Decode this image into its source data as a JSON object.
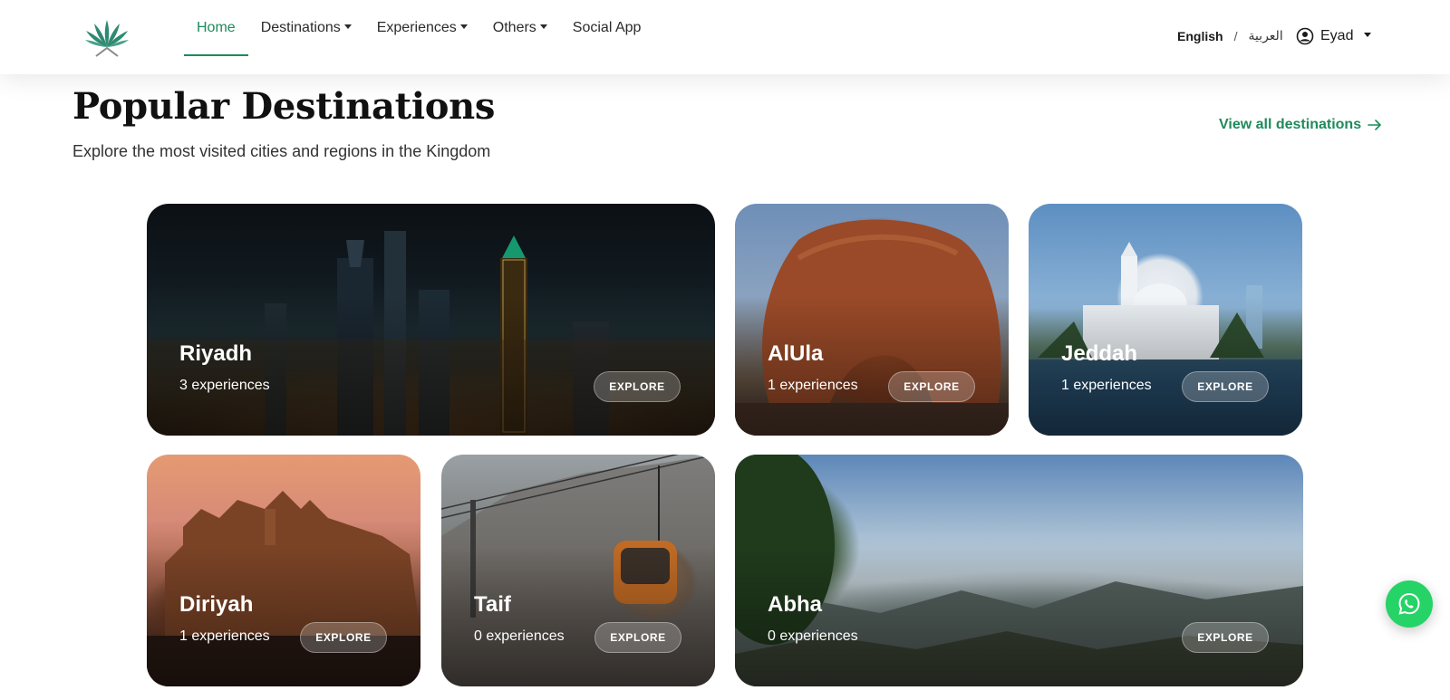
{
  "colors": {
    "accent": "#1f8a5b",
    "whatsapp": "#25d366"
  },
  "nav": {
    "items": [
      {
        "label": "Home",
        "icon": "",
        "active": true,
        "dropdown": false
      },
      {
        "label": "Destinations",
        "dropdown": true
      },
      {
        "label": "Experiences",
        "dropdown": true
      },
      {
        "label": "Others",
        "dropdown": true
      },
      {
        "label": "Social App",
        "dropdown": false
      }
    ],
    "lang_en": "English",
    "lang_sep": "/",
    "lang_ar": "العربية",
    "user_name": "Eyad",
    "user_icon": "user-circle-icon"
  },
  "section": {
    "title": "Popular Destinations",
    "subtitle": "Explore the most visited cities and regions in the Kingdom",
    "view_all": "View all destinations",
    "view_all_icon": "arrow-right-icon"
  },
  "destinations": [
    {
      "name": "Riyadh",
      "experiences": "3 experiences",
      "explore": "EXPLORE"
    },
    {
      "name": "AlUla",
      "experiences": "1 experiences",
      "explore": "EXPLORE"
    },
    {
      "name": "Jeddah",
      "experiences": "1 experiences",
      "explore": "EXPLORE"
    },
    {
      "name": "Diriyah",
      "experiences": "1 experiences",
      "explore": "EXPLORE"
    },
    {
      "name": "Taif",
      "experiences": "0 experiences",
      "explore": "EXPLORE"
    },
    {
      "name": "Abha",
      "experiences": "0 experiences",
      "explore": "EXPLORE"
    }
  ],
  "whatsapp_icon": "whatsapp-icon"
}
